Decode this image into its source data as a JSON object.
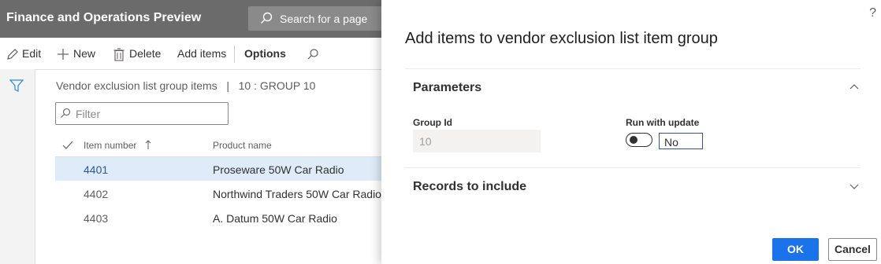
{
  "app": {
    "title": "Finance and Operations Preview",
    "search_label": "Search for a page"
  },
  "actions": {
    "edit": "Edit",
    "new": "New",
    "delete": "Delete",
    "add_items": "Add items",
    "options": "Options"
  },
  "breadcrumb": "Vendor exclusion list group items   |   10 : GROUP 10",
  "filter": {
    "placeholder": "Filter"
  },
  "grid": {
    "columns": [
      "Item number",
      "Product name"
    ],
    "rows": [
      {
        "item": "4401",
        "product": "Proseware 50W Car Radio",
        "selected": true
      },
      {
        "item": "4402",
        "product": "Northwind Traders 50W Car Radio",
        "selected": false
      },
      {
        "item": "4403",
        "product": "A. Datum 50W Car Radio",
        "selected": false
      }
    ]
  },
  "dialog": {
    "help": "?",
    "title": "Add items to vendor exclusion list item group",
    "parameters": {
      "title": "Parameters",
      "group_id_label": "Group Id",
      "group_id_value": "10",
      "run_with_update_label": "Run with update",
      "run_with_update_value": "No"
    },
    "records_title": "Records to include",
    "ok": "OK",
    "cancel": "Cancel"
  },
  "colors": {
    "appbar": "#6b6b6b",
    "accent": "#1a73e8",
    "selected_row": "#deecf9"
  }
}
